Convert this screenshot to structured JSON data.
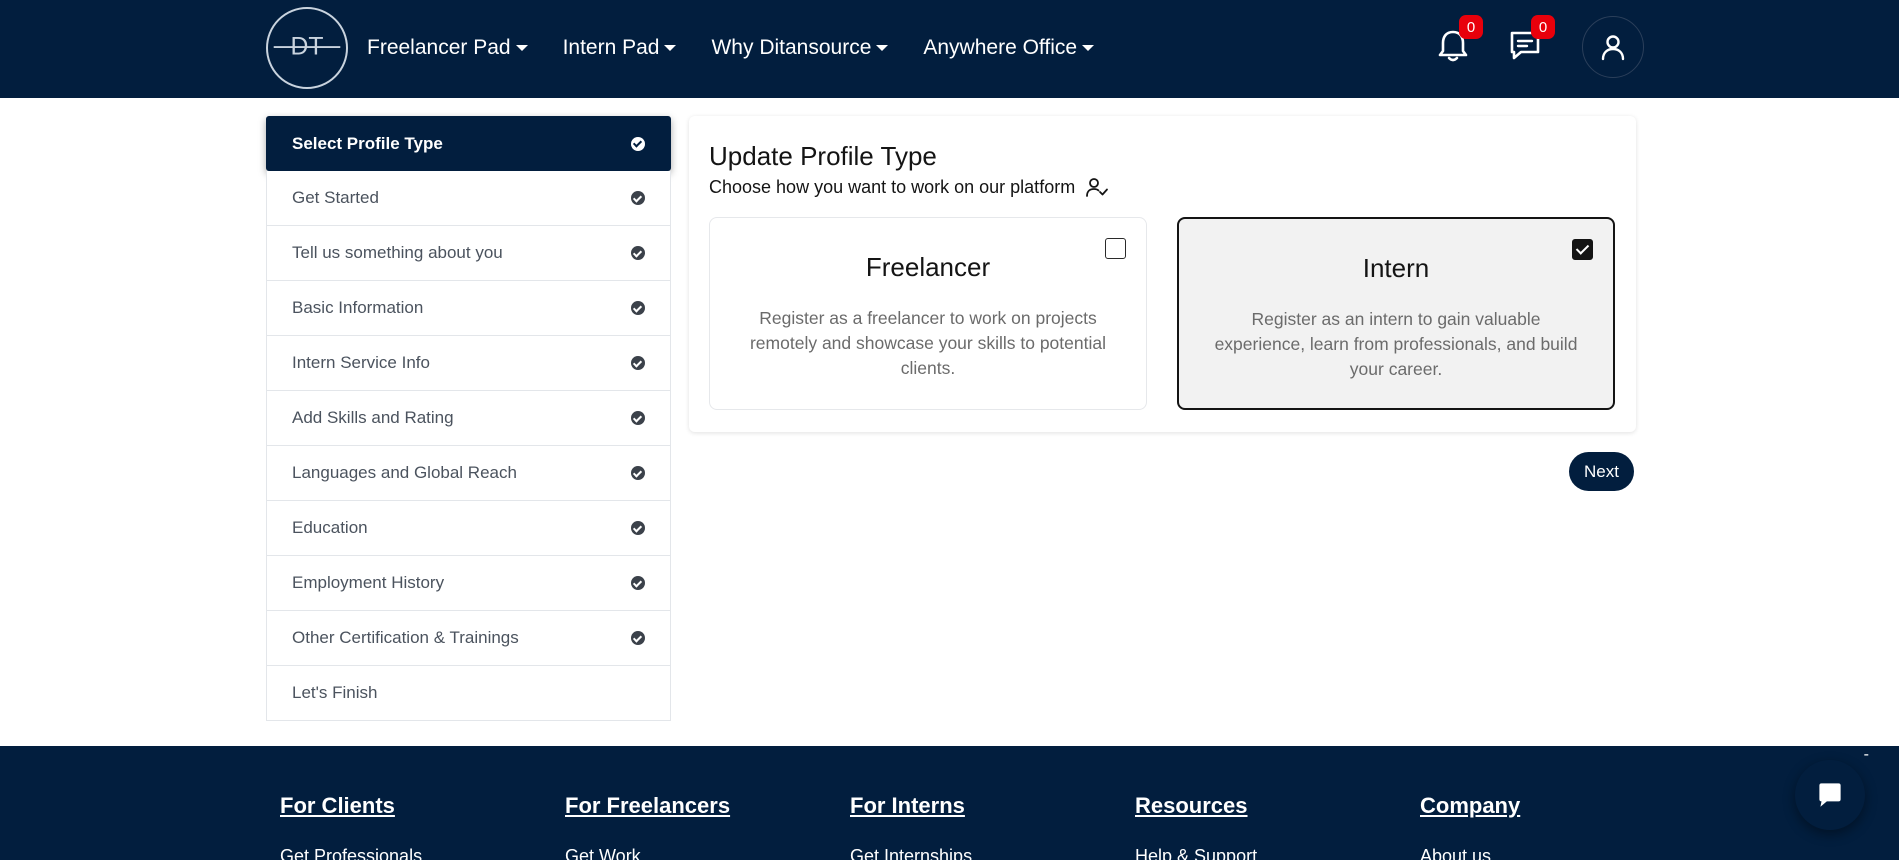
{
  "header": {
    "logo_text": "DT",
    "nav": [
      {
        "label": "Freelancer Pad"
      },
      {
        "label": "Intern Pad"
      },
      {
        "label": "Why Ditansource"
      },
      {
        "label": "Anywhere Office"
      }
    ],
    "notifications_count": "0",
    "messages_count": "0",
    "icons": [
      "bell-icon",
      "chat-bubble-icon",
      "user-icon"
    ]
  },
  "sidebar": {
    "items": [
      {
        "label": "Select Profile Type",
        "active": true,
        "completed": true
      },
      {
        "label": "Get Started",
        "completed": true
      },
      {
        "label": "Tell us something about you",
        "completed": true
      },
      {
        "label": "Basic Information",
        "completed": true
      },
      {
        "label": "Intern Service Info",
        "completed": true
      },
      {
        "label": "Add Skills and Rating",
        "completed": true
      },
      {
        "label": "Languages and Global Reach",
        "completed": true
      },
      {
        "label": "Education",
        "completed": true
      },
      {
        "label": "Employment History",
        "completed": true
      },
      {
        "label": "Other Certification & Trainings",
        "completed": true
      },
      {
        "label": "Let's Finish",
        "completed": false
      }
    ]
  },
  "main": {
    "title": "Update Profile Type",
    "subtitle": "Choose how you want to work on our platform",
    "options": {
      "freelancer": {
        "title": "Freelancer",
        "description": "Register as a freelancer to work on projects remotely and showcase your skills to potential clients.",
        "checked": false
      },
      "intern": {
        "title": "Intern",
        "description": "Register as an intern to gain valuable experience, learn from professionals, and build your career.",
        "checked": true
      }
    },
    "next_label": "Next"
  },
  "footer": {
    "minimize": "-",
    "columns": [
      {
        "heading": "For Clients",
        "first_link": "Get Professionals"
      },
      {
        "heading": "For Freelancers",
        "first_link": "Get Work"
      },
      {
        "heading": "For Interns",
        "first_link": "Get Internships"
      },
      {
        "heading": "Resources",
        "first_link": "Help & Support"
      },
      {
        "heading": "Company",
        "first_link": "About us"
      }
    ]
  },
  "colors": {
    "brand_navy": "#021e3e",
    "badge_red": "#e8000b",
    "selected_card_bg": "#f2f2f2"
  }
}
